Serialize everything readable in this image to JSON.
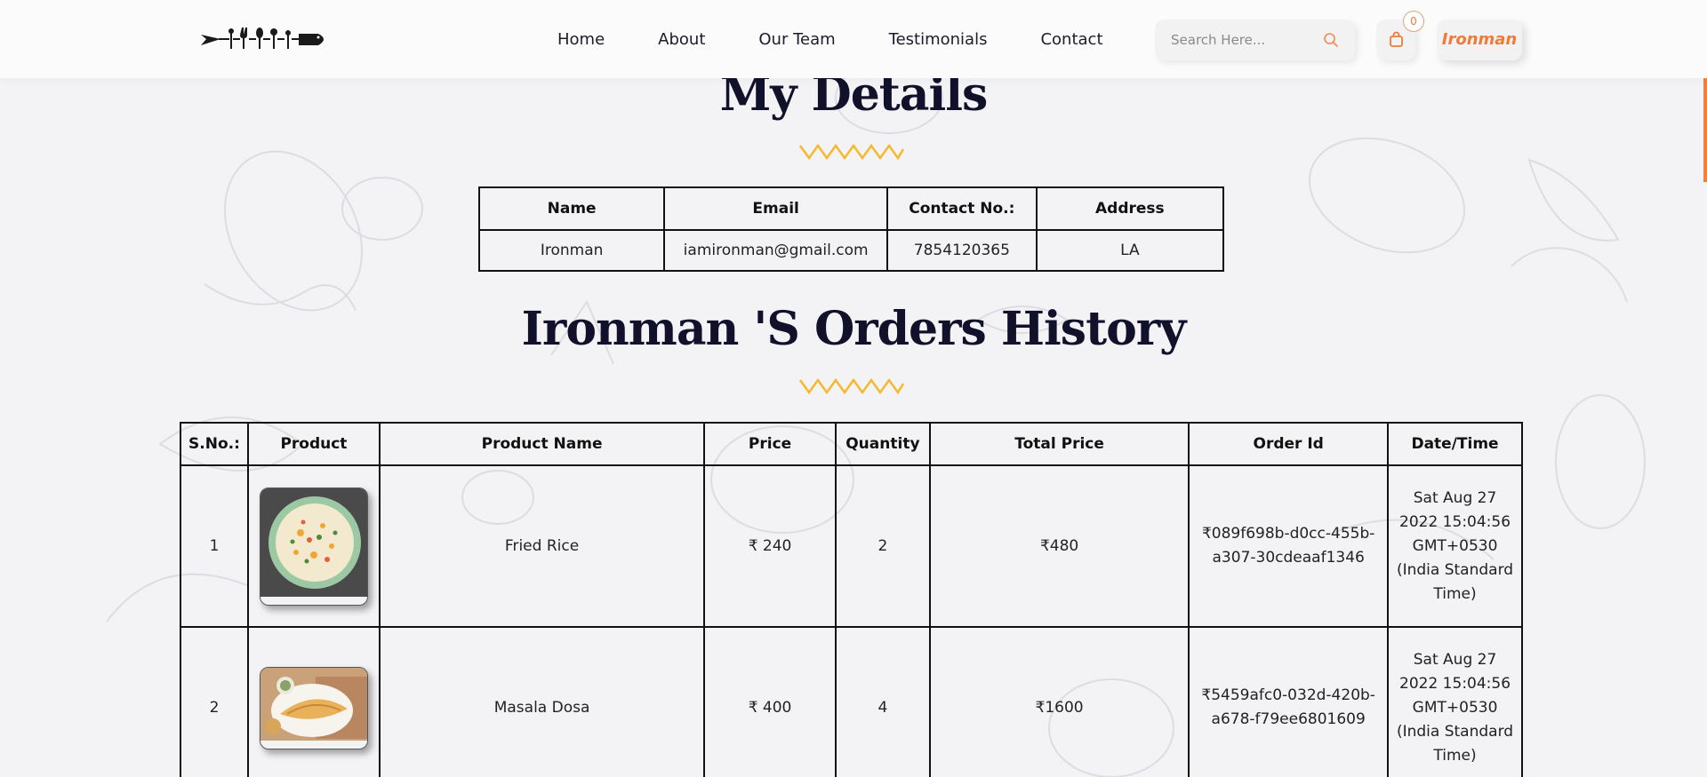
{
  "header": {
    "nav": [
      "Home",
      "About",
      "Our Team",
      "Testimonials",
      "Contact"
    ],
    "search_placeholder": "Search Here...",
    "cart_count": "0",
    "user_label": "Ironman"
  },
  "details": {
    "title": "My Details",
    "columns": [
      "Name",
      "Email",
      "Contact No.:",
      "Address"
    ],
    "row": [
      "Ironman",
      "iamironman@gmail.com",
      "7854120365",
      "LA"
    ]
  },
  "orders": {
    "title": "Ironman 'S Orders History",
    "columns": [
      "S.No.:",
      "Product",
      "Product Name",
      "Price",
      "Quantity",
      "Total Price",
      "Order Id",
      "Date/Time"
    ],
    "rows": [
      {
        "sno": "1",
        "image": "fried-rice-image",
        "name": "Fried Rice",
        "price": "₹ 240",
        "quantity": "2",
        "total": "₹480",
        "order_id": "₹089f698b-d0cc-455b-a307-30cdeaaf1346",
        "datetime": "Sat Aug 27 2022 15:04:56 GMT+0530 (India Standard Time)"
      },
      {
        "sno": "2",
        "image": "masala-dosa-image",
        "name": "Masala Dosa",
        "price": "₹ 400",
        "quantity": "4",
        "total": "₹1600",
        "order_id": "₹5459afc0-032d-420b-a678-f79ee6801609",
        "datetime": "Sat Aug 27 2022 15:04:56 GMT+0530 (India Standard Time)"
      }
    ]
  },
  "colors": {
    "accent": "#f07a3a",
    "heading": "#11112b",
    "zigzag": "#f5b82e",
    "background": "#f3f3f5"
  }
}
